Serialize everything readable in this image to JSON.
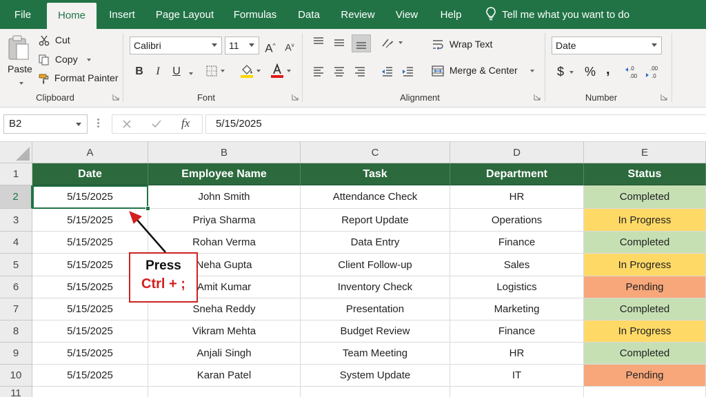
{
  "ribbon_tabs": [
    "File",
    "Home",
    "Insert",
    "Page Layout",
    "Formulas",
    "Data",
    "Review",
    "View",
    "Help"
  ],
  "tell_me": "Tell me what you want to do",
  "clipboard": {
    "paste": "Paste",
    "cut": "Cut",
    "copy": "Copy",
    "format_painter": "Format Painter",
    "group_label": "Clipboard"
  },
  "font": {
    "name": "Calibri",
    "size": "11",
    "group_label": "Font",
    "bold": "B",
    "italic": "I",
    "underline": "U",
    "grow": "A",
    "shrink": "A"
  },
  "alignment": {
    "wrap_text": "Wrap Text",
    "merge_center": "Merge & Center",
    "group_label": "Alignment"
  },
  "number": {
    "format": "Date",
    "currency": "$",
    "percent": "%",
    "comma": ",",
    "group_label": "Number"
  },
  "formula_bar": {
    "name_box": "B2",
    "fx": "fx",
    "value": "5/15/2025"
  },
  "grid": {
    "columns": [
      "A",
      "B",
      "C",
      "D",
      "E"
    ],
    "row_numbers": [
      "1",
      "2",
      "3",
      "4",
      "5",
      "6",
      "7",
      "8",
      "9",
      "10",
      "11"
    ],
    "header": [
      "Date",
      "Employee Name",
      "Task",
      "Department",
      "Status"
    ],
    "rows": [
      [
        "5/15/2025",
        "John Smith",
        "Attendance Check",
        "HR",
        "Completed"
      ],
      [
        "5/15/2025",
        "Priya Sharma",
        "Report Update",
        "Operations",
        "In Progress"
      ],
      [
        "5/15/2025",
        "Rohan Verma",
        "Data Entry",
        "Finance",
        "Completed"
      ],
      [
        "5/15/2025",
        "Neha Gupta",
        "Client Follow-up",
        "Sales",
        "In Progress"
      ],
      [
        "5/15/2025",
        "Amit Kumar",
        "Inventory Check",
        "Logistics",
        "Pending"
      ],
      [
        "5/15/2025",
        "Sneha Reddy",
        "Presentation",
        "Marketing",
        "Completed"
      ],
      [
        "5/15/2025",
        "Vikram Mehta",
        "Budget Review",
        "Finance",
        "In Progress"
      ],
      [
        "5/15/2025",
        "Anjali Singh",
        "Team Meeting",
        "HR",
        "Completed"
      ],
      [
        "5/15/2025",
        "Karan Patel",
        "System Update",
        "IT",
        "Pending"
      ]
    ]
  },
  "status_colors": {
    "Completed": "#c6e0b4",
    "In Progress": "#ffd966",
    "Pending": "#f8a77a"
  },
  "colors": {
    "excel_green": "#217346",
    "header_fill": "#2c6a3e",
    "annotation_red": "#d31f1f"
  },
  "annotation": {
    "line1": "Press",
    "line2": "Ctrl + ;"
  }
}
